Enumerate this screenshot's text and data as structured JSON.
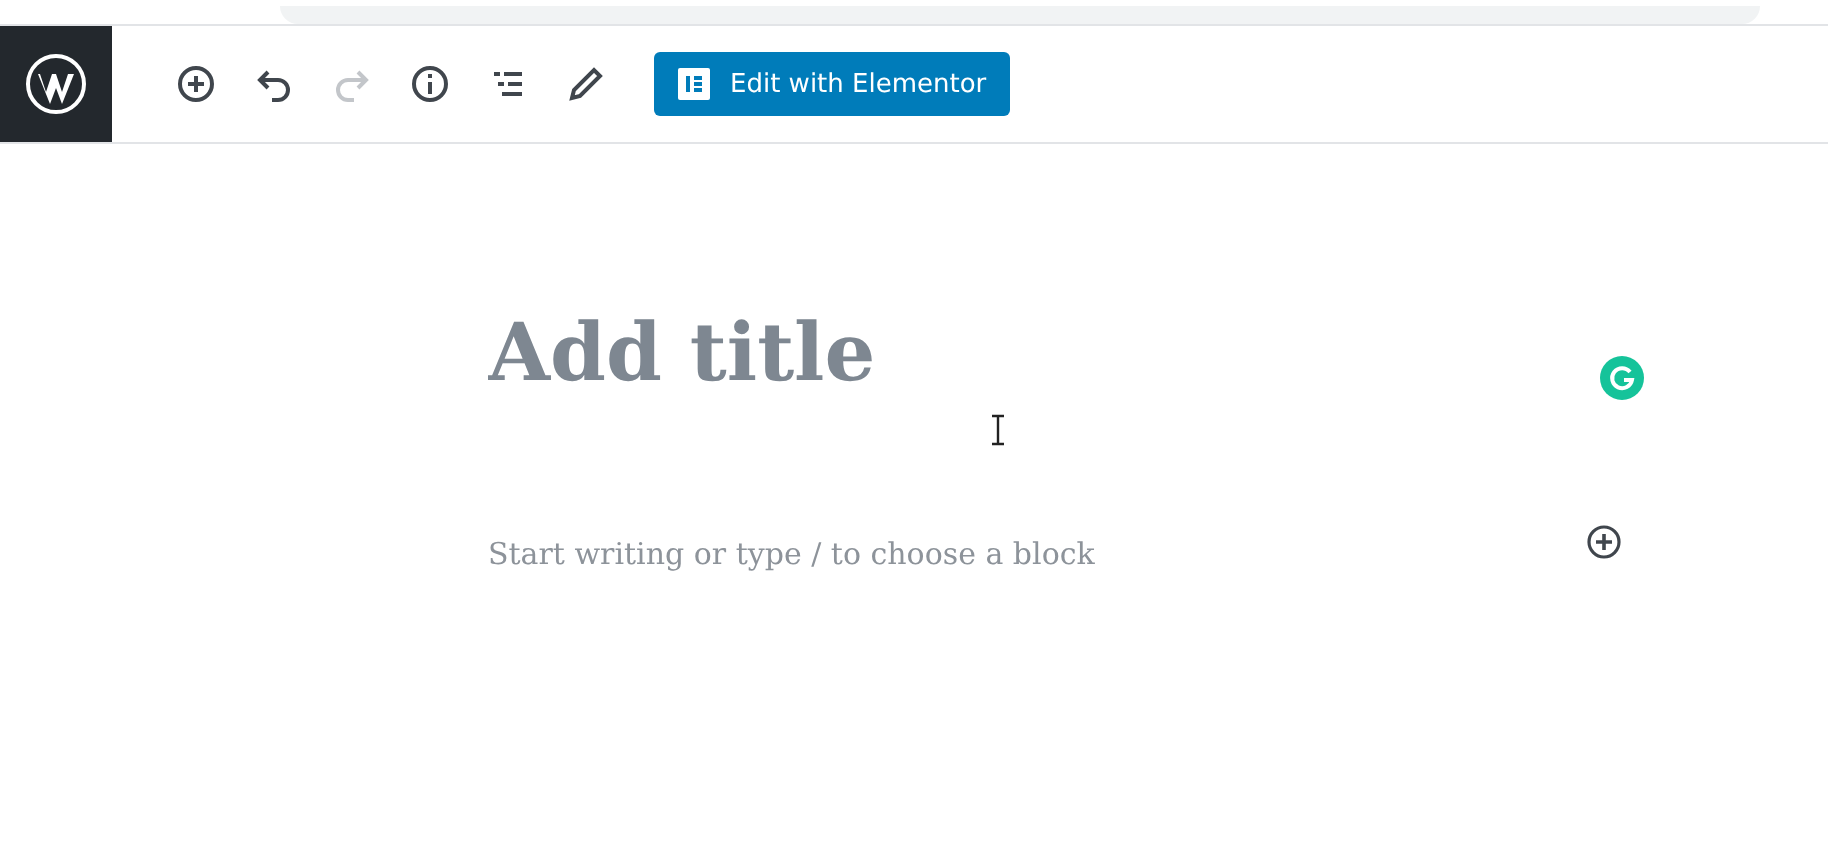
{
  "toolbar": {
    "tools": [
      {
        "kind": "add",
        "disabled": false
      },
      {
        "kind": "undo",
        "disabled": false
      },
      {
        "kind": "redo",
        "disabled": true
      },
      {
        "kind": "info",
        "disabled": false
      },
      {
        "kind": "outline",
        "disabled": false
      },
      {
        "kind": "edit",
        "disabled": false
      }
    ],
    "elementor_button": {
      "label": "Edit with Elementor"
    }
  },
  "editor": {
    "title": {
      "placeholder": "Add title"
    },
    "paragraph": {
      "placeholder": "Start writing or type / to choose a block"
    }
  }
}
